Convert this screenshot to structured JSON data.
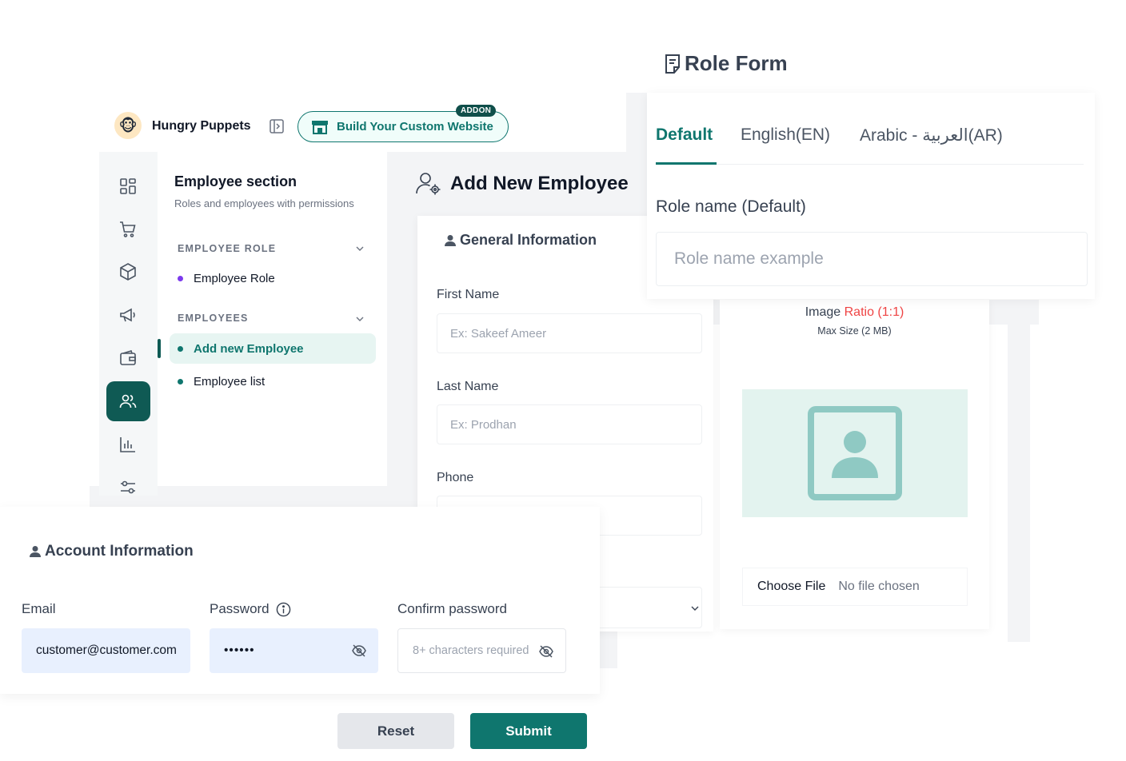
{
  "header": {
    "brand_name": "Hungry Puppets",
    "addon_badge": "ADDON",
    "addon_button": "Build Your Custom Website"
  },
  "sidebar_rail": {
    "icons": [
      "dashboard-icon",
      "cart-icon",
      "box-icon",
      "megaphone-icon",
      "wallet-icon",
      "users-icon",
      "chart-icon",
      "settings-sliders-icon"
    ],
    "active": "users-icon"
  },
  "employee_menu": {
    "title": "Employee section",
    "subtitle": "Roles and employees with permissions",
    "groups": [
      {
        "label": "EMPLOYEE ROLE",
        "items": [
          {
            "label": "Employee Role"
          }
        ]
      },
      {
        "label": "EMPLOYEES",
        "items": [
          {
            "label": "Add new Employee",
            "active": true
          },
          {
            "label": "Employee list"
          }
        ]
      }
    ]
  },
  "add_employee": {
    "title": "Add New Employee",
    "general_title": "General Information",
    "first_name_label": "First Name",
    "first_name_placeholder": "Ex: Sakeef Ameer",
    "last_name_label": "Last Name",
    "last_name_placeholder": "Ex: Prodhan",
    "phone_label": "Phone"
  },
  "role_form": {
    "title": "Role Form",
    "tabs": [
      "Default",
      "English(EN)",
      "Arabic - العربية(AR)"
    ],
    "active_tab": "Default",
    "role_name_label": "Role name (Default)",
    "role_name_placeholder": "Role name example"
  },
  "image_upload": {
    "label": "Image",
    "ratio": "Ratio (1:1)",
    "max_size": "Max Size (2 MB)",
    "choose_file": "Choose File",
    "no_file": "No file chosen"
  },
  "account": {
    "title": "Account Information",
    "email_label": "Email",
    "email_value": "customer@customer.com",
    "password_label": "Password",
    "password_value": "••••••",
    "confirm_label": "Confirm password",
    "confirm_placeholder": "8+ characters required"
  },
  "actions": {
    "reset": "Reset",
    "submit": "Submit"
  },
  "colors": {
    "primary": "#0f766e",
    "active_dark": "#0f5a54",
    "ratio_red": "#ef4444",
    "dot_purple": "#7c3aed"
  }
}
